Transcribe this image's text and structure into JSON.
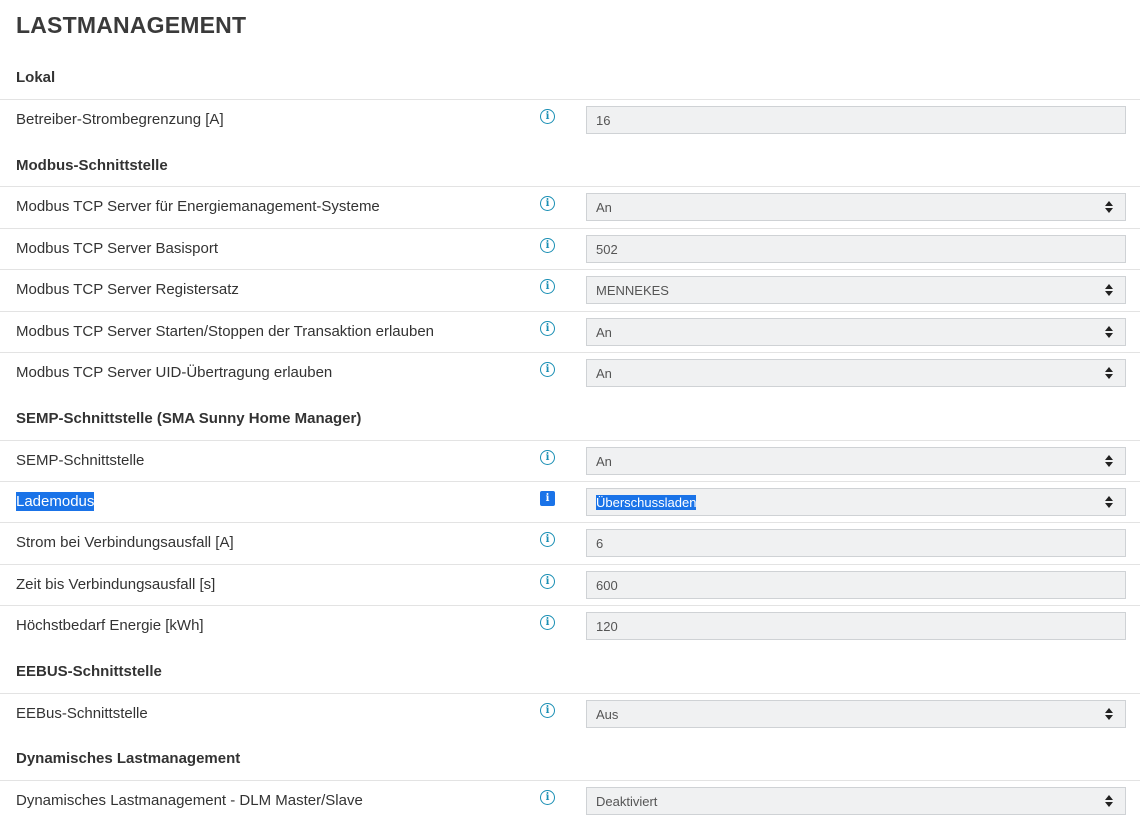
{
  "page": {
    "title": "LASTMANAGEMENT"
  },
  "sections": {
    "lokal": {
      "title": "Lokal",
      "betreiber_strombegrenzung": {
        "label": "Betreiber-Strombegrenzung [A]",
        "value": "16"
      }
    },
    "modbus": {
      "title": "Modbus-Schnittstelle",
      "tcp_server_ems": {
        "label": "Modbus TCP Server für Energiemanagement-Systeme",
        "value": "An"
      },
      "basisport": {
        "label": "Modbus TCP Server Basisport",
        "value": "502"
      },
      "registersatz": {
        "label": "Modbus TCP Server Registersatz",
        "value": "MENNEKES"
      },
      "start_stop": {
        "label": "Modbus TCP Server Starten/Stoppen der Transaktion erlauben",
        "value": "An"
      },
      "uid": {
        "label": "Modbus TCP Server UID-Übertragung erlauben",
        "value": "An"
      }
    },
    "semp": {
      "title": "SEMP-Schnittstelle (SMA Sunny Home Manager)",
      "semp_schnittstelle": {
        "label": "SEMP-Schnittstelle",
        "value": "An"
      },
      "lademodus": {
        "label": "Lademodus",
        "value": "Überschussladen"
      },
      "strom_ausfall": {
        "label": "Strom bei Verbindungsausfall [A]",
        "value": "6"
      },
      "zeit_ausfall": {
        "label": "Zeit bis Verbindungsausfall [s]",
        "value": "600"
      },
      "hoechstbedarf": {
        "label": "Höchstbedarf Energie [kWh]",
        "value": "120"
      }
    },
    "eebus": {
      "title": "EEBUS-Schnittstelle",
      "eebus_schnittstelle": {
        "label": "EEBus-Schnittstelle",
        "value": "Aus"
      }
    },
    "dlm": {
      "title": "Dynamisches Lastmanagement",
      "master_slave": {
        "label": "Dynamisches Lastmanagement - DLM Master/Slave",
        "value": "Deaktiviert"
      }
    }
  },
  "icons": {
    "info": "info-icon",
    "select_caret": "chevron-updown-icon"
  },
  "colors": {
    "accent": "#1a8fb4",
    "selection": "#1a73e8",
    "field_bg": "#f0f1f2"
  }
}
